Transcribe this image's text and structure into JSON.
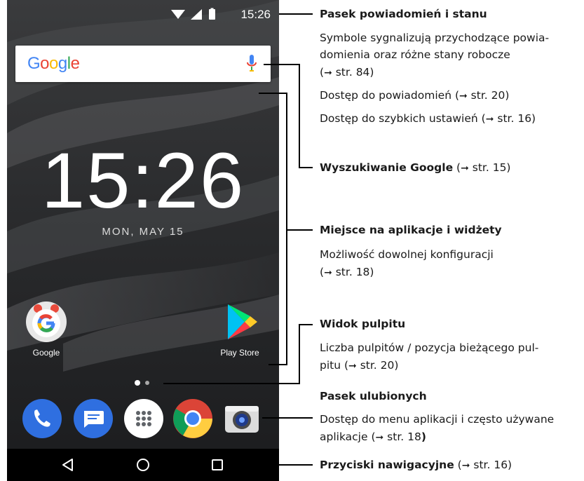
{
  "status_bar": {
    "time": "15:26"
  },
  "search_bar": {
    "logo": "Google"
  },
  "home": {
    "clock": "15:26",
    "date": "MON, MAY 15",
    "apps": [
      {
        "label": "Google"
      },
      {
        "label": "Play Store"
      }
    ],
    "page_indicator": {
      "count": 2,
      "current": 1
    }
  },
  "dock": {
    "apps": [
      "phone-icon",
      "messages-icon",
      "app-drawer-icon",
      "chrome-icon",
      "camera-icon"
    ]
  },
  "navbar": {
    "buttons": [
      "back-icon",
      "home-icon",
      "recents-icon"
    ]
  },
  "callouts": {
    "status_title": "Pasek powiadomień i stanu",
    "status_line1": "Symbole sygnalizują przychodzące powia-",
    "status_line2": "domienia oraz różne stany robocze",
    "status_ref": "str. 84)",
    "notif_access": "Dostęp do powiadomień (",
    "notif_ref": "str. 20)",
    "quick_access": "Dostęp do szybkich ustawień (",
    "quick_ref": "str. 16)",
    "google_title": "Wyszukiwanie Google",
    "google_ref": "str. 15)",
    "apps_title": "Miejsce na aplikacje i widżety",
    "apps_line1": "Możliwość dowolnej konfiguracji",
    "apps_ref": "str. 18)",
    "desktop_title": "Widok pulpitu",
    "desktop_line1": "Liczba pulpitów / pozycja bieżącego pul-",
    "desktop_line2": "pitu (",
    "desktop_ref": "str. 20)",
    "fav_title": "Pasek ulubionych",
    "fav_line1": "Dostęp do menu aplikacji i często używane",
    "fav_line2": "aplikacje (",
    "fav_ref": "str. 18",
    "fav_close": ")",
    "nav_title": "Przyciski nawigacyjne",
    "nav_ref": "str. 16)",
    "open_paren": " (",
    "open_paren_only": "(",
    "arrow_symbol": "➞"
  }
}
